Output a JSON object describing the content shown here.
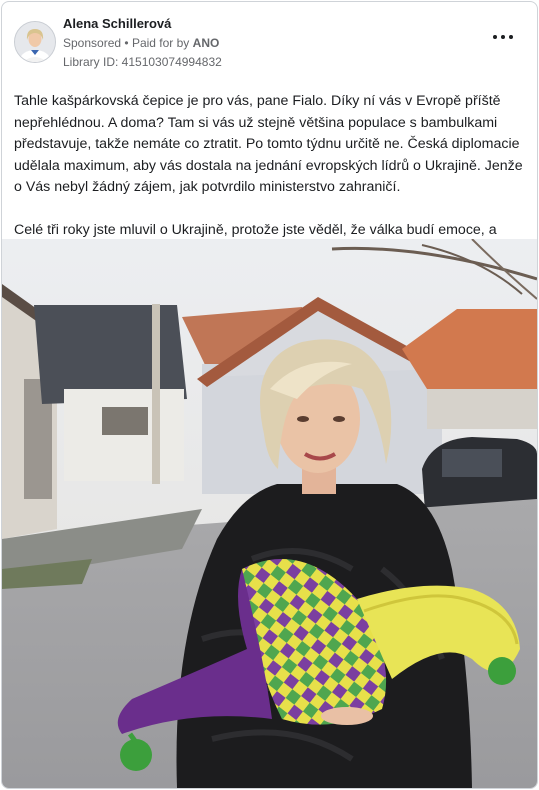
{
  "post": {
    "author": "Alena Schillerová",
    "sponsored": "Sponsored",
    "separator": "•",
    "paid_for_by_prefix": "Paid for by",
    "paid_for_by": "ANO",
    "library_id": "Library ID: 415103074994832",
    "more_icon": "more-horizontal-icon",
    "text_paragraph_1": "Tahle kašpárkovská čepice je pro vás, pane Fialo. Díky ní vás v Evropě příště nepřehlédnou. A doma? Tam si vás už stejně většina populace s bambulkami představuje, takže nemáte co ztratit. Po tomto týdnu určitě ne. Česká diplomacie udělala maximum, aby vás dostala na jednání evropských lídrů o Ukrajině. Jenže o Vás nebyl žádný zájem, jak potvrdilo ministerstvo zahraničí.",
    "text_paragraph_2": "Celé tři roky jste mluvil o Ukrajině, protože jste věděl, že válka budí emoce, a kro…"
  },
  "colors": {
    "text_primary": "#1c1e21",
    "text_secondary": "#65676b",
    "border": "#cfd3d8"
  }
}
